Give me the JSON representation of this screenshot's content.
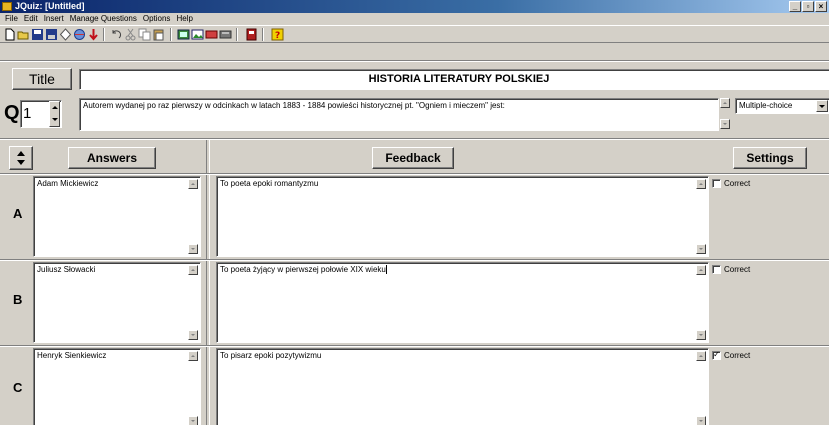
{
  "window": {
    "title": "JQuiz: [Untitled]",
    "min": "_",
    "max": "▫",
    "close": "×"
  },
  "menu": [
    "File",
    "Edit",
    "Insert",
    "Manage Questions",
    "Options",
    "Help"
  ],
  "toolbar": {
    "icons": [
      "new-file-icon",
      "open-folder-icon",
      "save-icon",
      "save-as-icon",
      "erase-icon",
      "web-page-icon",
      "upload-icon",
      "undo-icon",
      "cut-icon",
      "copy-icon",
      "paste-icon",
      "config-icon",
      "image-icon",
      "link-icon",
      "export-icon",
      "book-icon",
      "help-icon"
    ]
  },
  "title": {
    "button": "Title",
    "value": "HISTORIA LITERATURY POLSKIEJ"
  },
  "question": {
    "label": "Q",
    "number": "1",
    "text": "Autorem wydanej po raz pierwszy w odcinkach w latach 1883 - 1884 powieści historycznej pt. \"Ogniem i mieczem\" jest:",
    "type": "Multiple-choice"
  },
  "headers": {
    "answers": "Answers",
    "feedback": "Feedback",
    "settings": "Settings"
  },
  "rows": [
    {
      "letter": "A",
      "answer": "Adam Mickiewicz",
      "feedback": "To poeta epoki romantyzmu",
      "correct_label": "Correct",
      "correct": false
    },
    {
      "letter": "B",
      "answer": "Juliusz Słowacki",
      "feedback": "To poeta żyjący w pierwszej połowie XIX wieku",
      "correct_label": "Correct",
      "correct": false
    },
    {
      "letter": "C",
      "answer": "Henryk Sienkiewicz",
      "feedback": "To pisarz epoki pozytywizmu",
      "correct_label": "Correct",
      "correct": true
    }
  ],
  "colors": {
    "face": "#d4d0c8",
    "titlebar": "#0a246a"
  }
}
